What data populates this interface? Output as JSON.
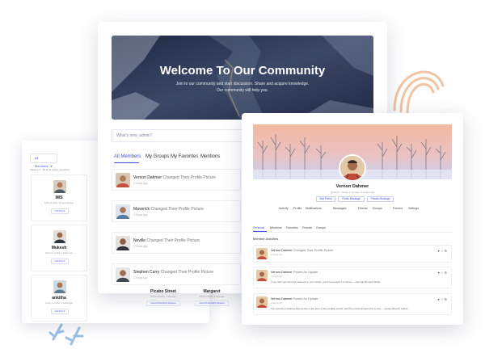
{
  "colors": {
    "accent": "#3f51d8",
    "cover_peach": "#f3b9a2",
    "cover_sky": "#c9d2ee",
    "hero_dark": "#2b3350",
    "deco_peach": "#f1c4a4",
    "deco_leaf": "#9cc0e8"
  },
  "members_directory": {
    "filter_label": "All Members",
    "showing_text": "Viewing 1 - 20 of 34 active members",
    "members": [
      {
        "name": "IMS",
        "meta": "Active 8 hours, 50 seconds ago",
        "button": "Add Friend"
      },
      {
        "name": "Mukesh",
        "meta": "Active 8 months, 2 weeks ago",
        "button": "Add Friend"
      },
      {
        "name": "ankitha",
        "meta": "Active 4 months, 2 weeks ago",
        "button": "Add Friend"
      }
    ],
    "lower_members": [
      {
        "name": "Picabo Street",
        "meta": "Active 4 weeks, 2 days ago",
        "button": "Cancel Friendship Request"
      },
      {
        "name": "Margaret",
        "meta": "Active 4 weeks, 2 days ago",
        "button": "Cancel Friendship Request"
      }
    ]
  },
  "community": {
    "hero_title": "Welcome To Our Community",
    "hero_subtitle_1": "Join to our community and start discussion. Share and acquire knowledge.",
    "hero_subtitle_2": "Our community will help you.",
    "search_placeholder": "What's new, admin?",
    "tabs": [
      "All Members",
      "My Groups",
      "My Favorites",
      "Mentions"
    ],
    "activities": [
      {
        "name": "Vernon Dahmer",
        "action": "Changed Their Profile Picture",
        "time": "2 Hours Ago"
      },
      {
        "name": "Maverick",
        "action": "Changed Their Profile Picture",
        "time": "2 Hours Ago"
      },
      {
        "name": "Neville",
        "action": "Changed Their Profile Picture",
        "time": "2 Hours Ago"
      },
      {
        "name": "Stephen Curry",
        "action": "Changed Their Profile Picture",
        "time": "2 Hours Ago"
      }
    ]
  },
  "profile": {
    "name": "Vernon Dahmer",
    "meta": "@admin • Active 2 minutes, 2 weeks ago",
    "buttons": [
      "Add Friend",
      "Public Message",
      "Private Message"
    ],
    "nav": [
      {
        "label": "Activity",
        "count": ""
      },
      {
        "label": "Profile",
        "count": ""
      },
      {
        "label": "Notifications",
        "count": "4"
      },
      {
        "label": "Messages",
        "count": "5"
      },
      {
        "label": "Friends",
        "count": ""
      },
      {
        "label": "Groups",
        "count": "3"
      },
      {
        "label": "Forums",
        "count": ""
      },
      {
        "label": "Settings",
        "count": ""
      }
    ],
    "subtabs": [
      "Personal",
      "Mentions",
      "Favorites",
      "Friends",
      "Groups"
    ],
    "section_title": "Member Activities",
    "activities": [
      {
        "name": "Vernon Dahmer",
        "action": "Changed Their Profile Picture",
        "time": "2 Hours Ago",
        "body": ""
      },
      {
        "name": "Vernon Dahmer",
        "action": "Posted An Update",
        "time": "2 Hours Ago",
        "body": "If you can't get rid of the skeleton in your closet, you'd best teach it to dance. —George Bernard Shaw"
      },
      {
        "name": "Vernon Dahmer",
        "action": "Posted An Update",
        "time": "2 Hours Ago",
        "body": "The optimist proclaims that we live in the best of all possible worlds; and the pessimist fears this is true. —James Branch Cabell"
      }
    ]
  }
}
